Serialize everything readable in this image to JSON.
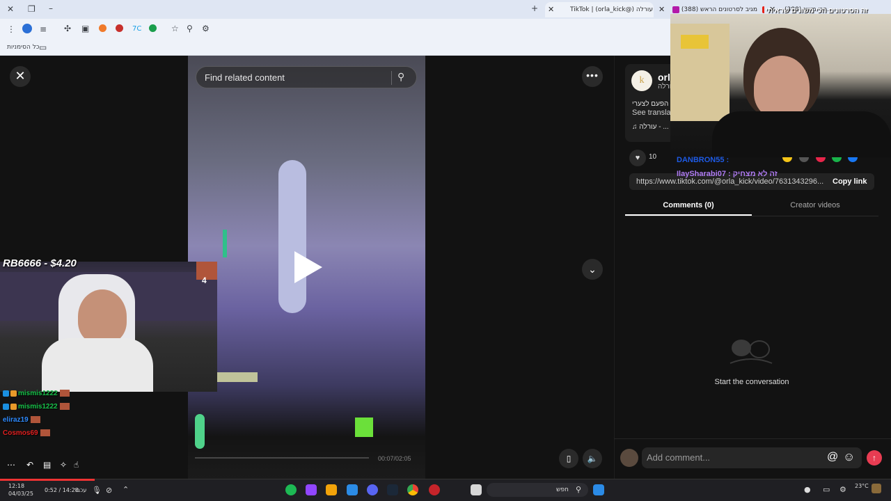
{
  "browser": {
    "tabs": [
      {
        "label": "TikTok | (orla_kick@) עורלה",
        "active": true
      },
      {
        "label": "(388) מגיב לסרטונים הראש",
        "active": false
      },
      {
        "label": "(388) הכי משונ...",
        "active": false
      }
    ],
    "bookmarks_label": "כל הסימניות"
  },
  "video": {
    "search_placeholder": "Find related content",
    "time_code": "00:07/02:05",
    "icons": {
      "close": "close-icon",
      "more": "more-icon",
      "down": "chevron-down-icon",
      "play": "play-icon",
      "search": "search-icon",
      "device": "device-icon",
      "volume": "volume-icon"
    }
  },
  "panel": {
    "creator_name": "orl",
    "creator_sub": "עורלה",
    "caption": "הפעם לצערי",
    "see_translation": "See translat",
    "music": "♫  עורלה - ...",
    "like_count": "10",
    "link_url": "https://www.tiktok.com/@orla_kick/video/7631343296...",
    "copy_link": "Copy link",
    "tabs": {
      "comments": "Comments (0)",
      "creator_videos": "Creator videos"
    },
    "empty_state": "Start the conversation",
    "comment_placeholder": "Add comment...",
    "at_symbol": "@",
    "emoji_symbol": "☺",
    "send_symbol": "↑",
    "share_colors": [
      "#f5c518",
      "#555555",
      "#e8254a",
      "#19b34a",
      "#1877f2"
    ]
  },
  "stream": {
    "overlay_title": "זה הסרטונים הכי משונים שראיתי",
    "donation": "RB6666 - $4.20",
    "emote_count": "4",
    "chat_user_top": "DANBRON55 :",
    "chat_user2": "IlaySharabi07 : זה לא מצחיק",
    "chat": [
      {
        "user": "mismis1222",
        "color": "#18c24a"
      },
      {
        "user": "mismis1222",
        "color": "#18c24a"
      },
      {
        "user": "eliraz19",
        "color": "#2e8bff"
      },
      {
        "user": "Cosmos69",
        "color": "#e02020"
      }
    ]
  },
  "taskbar": {
    "clock_time": "12:18",
    "clock_date": "04/03/25",
    "media_time": "0:52 / 14:28",
    "media_label": "עכבר",
    "search_label": "חפש",
    "weather": "23°C"
  }
}
